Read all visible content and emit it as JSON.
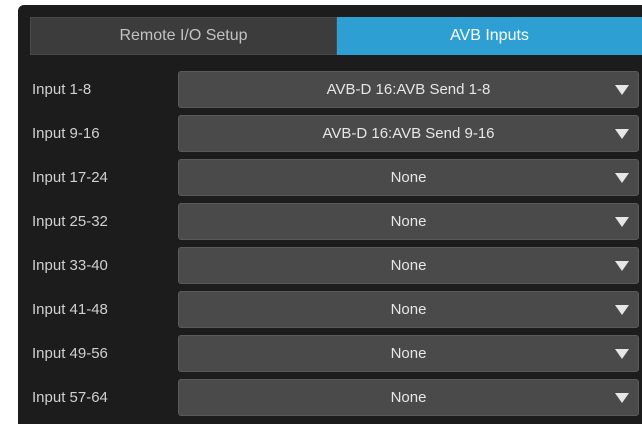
{
  "tabs": [
    {
      "label": "Remote I/O Setup",
      "active": false
    },
    {
      "label": "AVB Inputs",
      "active": true
    }
  ],
  "rows": [
    {
      "label": "Input 1-8",
      "value": "AVB-D 16:AVB Send 1-8"
    },
    {
      "label": "Input 9-16",
      "value": "AVB-D 16:AVB Send 9-16"
    },
    {
      "label": "Input 17-24",
      "value": "None"
    },
    {
      "label": "Input 25-32",
      "value": "None"
    },
    {
      "label": "Input 33-40",
      "value": "None"
    },
    {
      "label": "Input 41-48",
      "value": "None"
    },
    {
      "label": "Input 49-56",
      "value": "None"
    },
    {
      "label": "Input 57-64",
      "value": "None"
    }
  ],
  "icons": {
    "dropdown": "triangle-down-icon"
  },
  "colors": {
    "panel_bg": "#1c1c1c",
    "tab_active": "#2e9fd3",
    "tab_inactive": "#3c3c3c",
    "dropdown_bg": "#4a4a4a",
    "text": "#d0d0d0"
  }
}
